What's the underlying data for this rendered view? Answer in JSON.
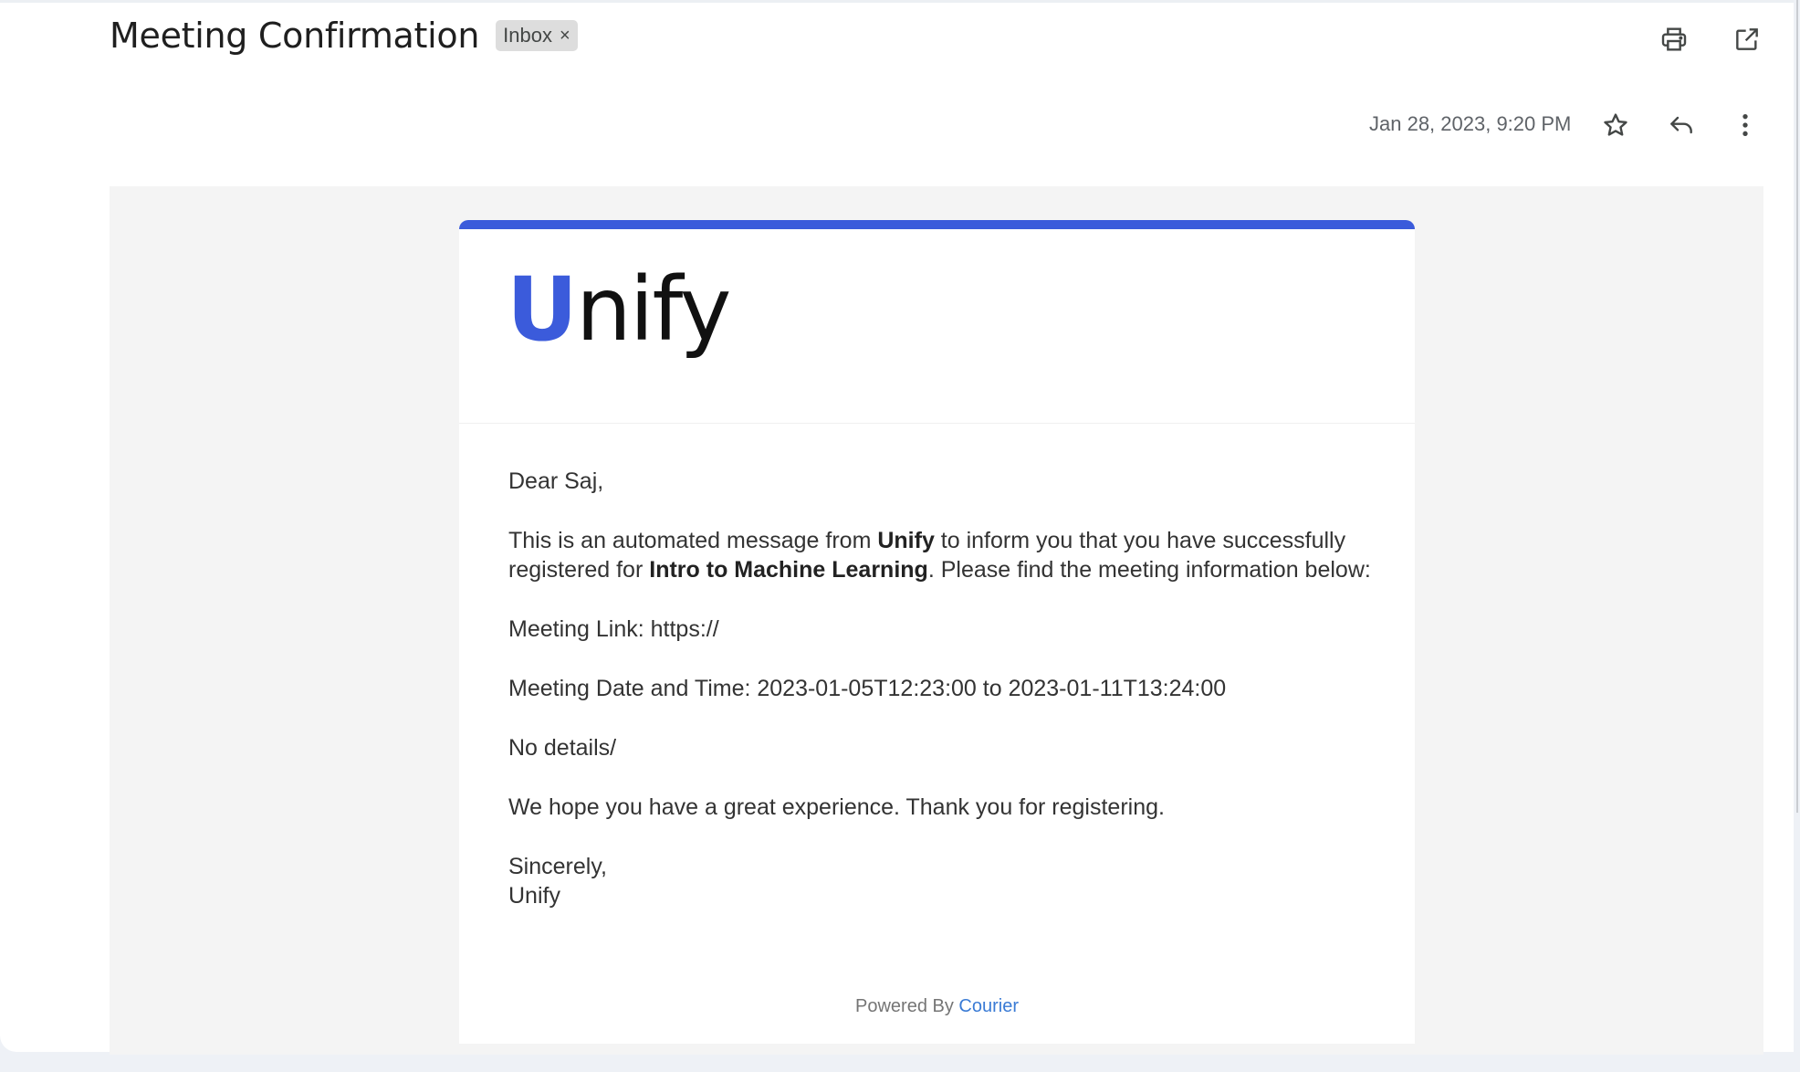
{
  "header": {
    "subject": "Meeting Confirmation",
    "label_chip": "Inbox",
    "label_remove": "×",
    "date": "Jan 28, 2023, 9:20 PM",
    "icons": {
      "print": "print-icon",
      "open_new_window": "open-in-new-window-icon",
      "star": "star-icon",
      "reply": "reply-icon",
      "more": "more-vertical-icon"
    }
  },
  "email": {
    "logo": {
      "first_letter": "U",
      "rest": "nify",
      "first_letter_color": "#3b5bdb"
    },
    "accent_color": "#3b5bdb",
    "greeting": "Dear Saj,",
    "intro_part1": "This is an automated message from ",
    "intro_org": "Unify",
    "intro_part2": " to inform you that you have successfully registered for ",
    "intro_event": "Intro to Machine Learning",
    "intro_part3": ". Please find the meeting information below:",
    "meeting_link": "Meeting Link: https://",
    "meeting_datetime": "Meeting Date and Time: 2023-01-05T12:23:00 to 2023-01-11T13:24:00",
    "details": "No details/",
    "closing_line": "We hope you have a great experience. Thank you for registering.",
    "signoff": "Sincerely,",
    "signature": "Unify",
    "powered_by_text": "Powered By ",
    "powered_by_link": "Courier",
    "link_color": "#3a7bd5"
  }
}
